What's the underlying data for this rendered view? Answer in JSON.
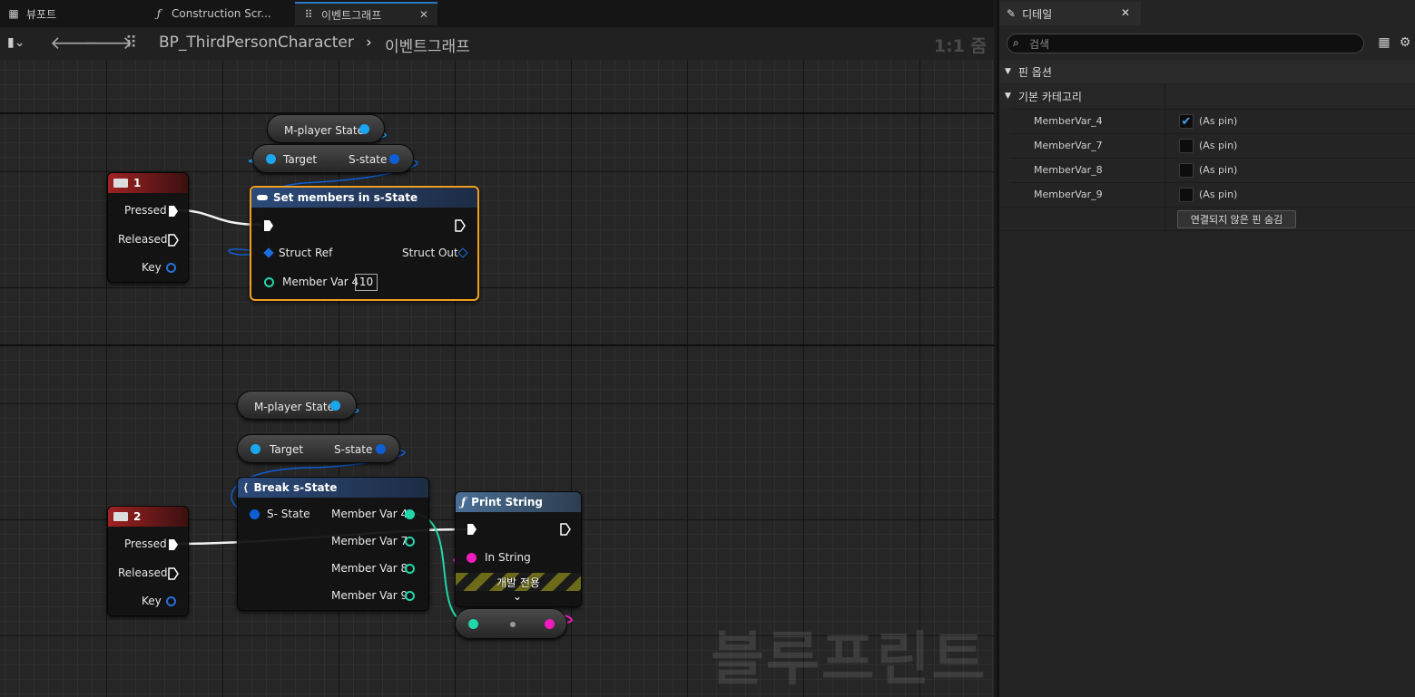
{
  "tabs": [
    {
      "label": "뷰포트",
      "icon": "grid-icon",
      "active": false
    },
    {
      "label": "Construction Scr...",
      "icon": "function-icon",
      "active": false
    },
    {
      "label": "이벤트그래프",
      "icon": "graph-icon",
      "active": true
    }
  ],
  "breadcrumb": {
    "blueprint": "BP_ThirdPersonCharacter",
    "graph": "이벤트그래프",
    "zoom": "1:1 줌"
  },
  "watermark": "블루프린트",
  "nodes": {
    "key1": {
      "title": "1",
      "pins": [
        "Pressed",
        "Released",
        "Key"
      ]
    },
    "key2": {
      "title": "2",
      "pins": [
        "Pressed",
        "Released",
        "Key"
      ]
    },
    "getter1": {
      "label": "M-player State"
    },
    "getter2": {
      "label": "M-player State"
    },
    "struct1": {
      "target": "Target",
      "out": "S-state"
    },
    "struct2": {
      "target": "Target",
      "out": "S-state"
    },
    "setmembers": {
      "title": "Set members in s-State",
      "struct_ref": "Struct Ref",
      "struct_out": "Struct Out",
      "member": "Member Var 4",
      "member_value": "10"
    },
    "break": {
      "title": "Break s-State",
      "input": "S- State",
      "outputs": [
        "Member Var 4",
        "Member Var 7",
        "Member Var 8",
        "Member Var 9"
      ]
    },
    "print": {
      "title": "Print String",
      "in_string": "In String",
      "dev_only": "개발 전용"
    }
  },
  "details": {
    "tab_label": "디테일",
    "search_placeholder": "검색",
    "section": "핀 옵션",
    "category": "기본 카테고리",
    "rows": [
      {
        "name": "MemberVar_4",
        "value": "(As pin)",
        "checked": true
      },
      {
        "name": "MemberVar_7",
        "value": "(As pin)",
        "checked": false
      },
      {
        "name": "MemberVar_8",
        "value": "(As pin)",
        "checked": false
      },
      {
        "name": "MemberVar_9",
        "value": "(As pin)",
        "checked": false
      }
    ],
    "hide_button": "연결되지 않은 핀 숨김"
  },
  "colors": {
    "exec_red": "#8a1d1d",
    "struct_blue": "#2b4a7a",
    "func_blue": "#4a6f96",
    "select_orange": "#f0a020",
    "struct_pin": "#1aa7f0",
    "int_pin": "#21d6a8",
    "string_pin": "#f01bbd"
  }
}
